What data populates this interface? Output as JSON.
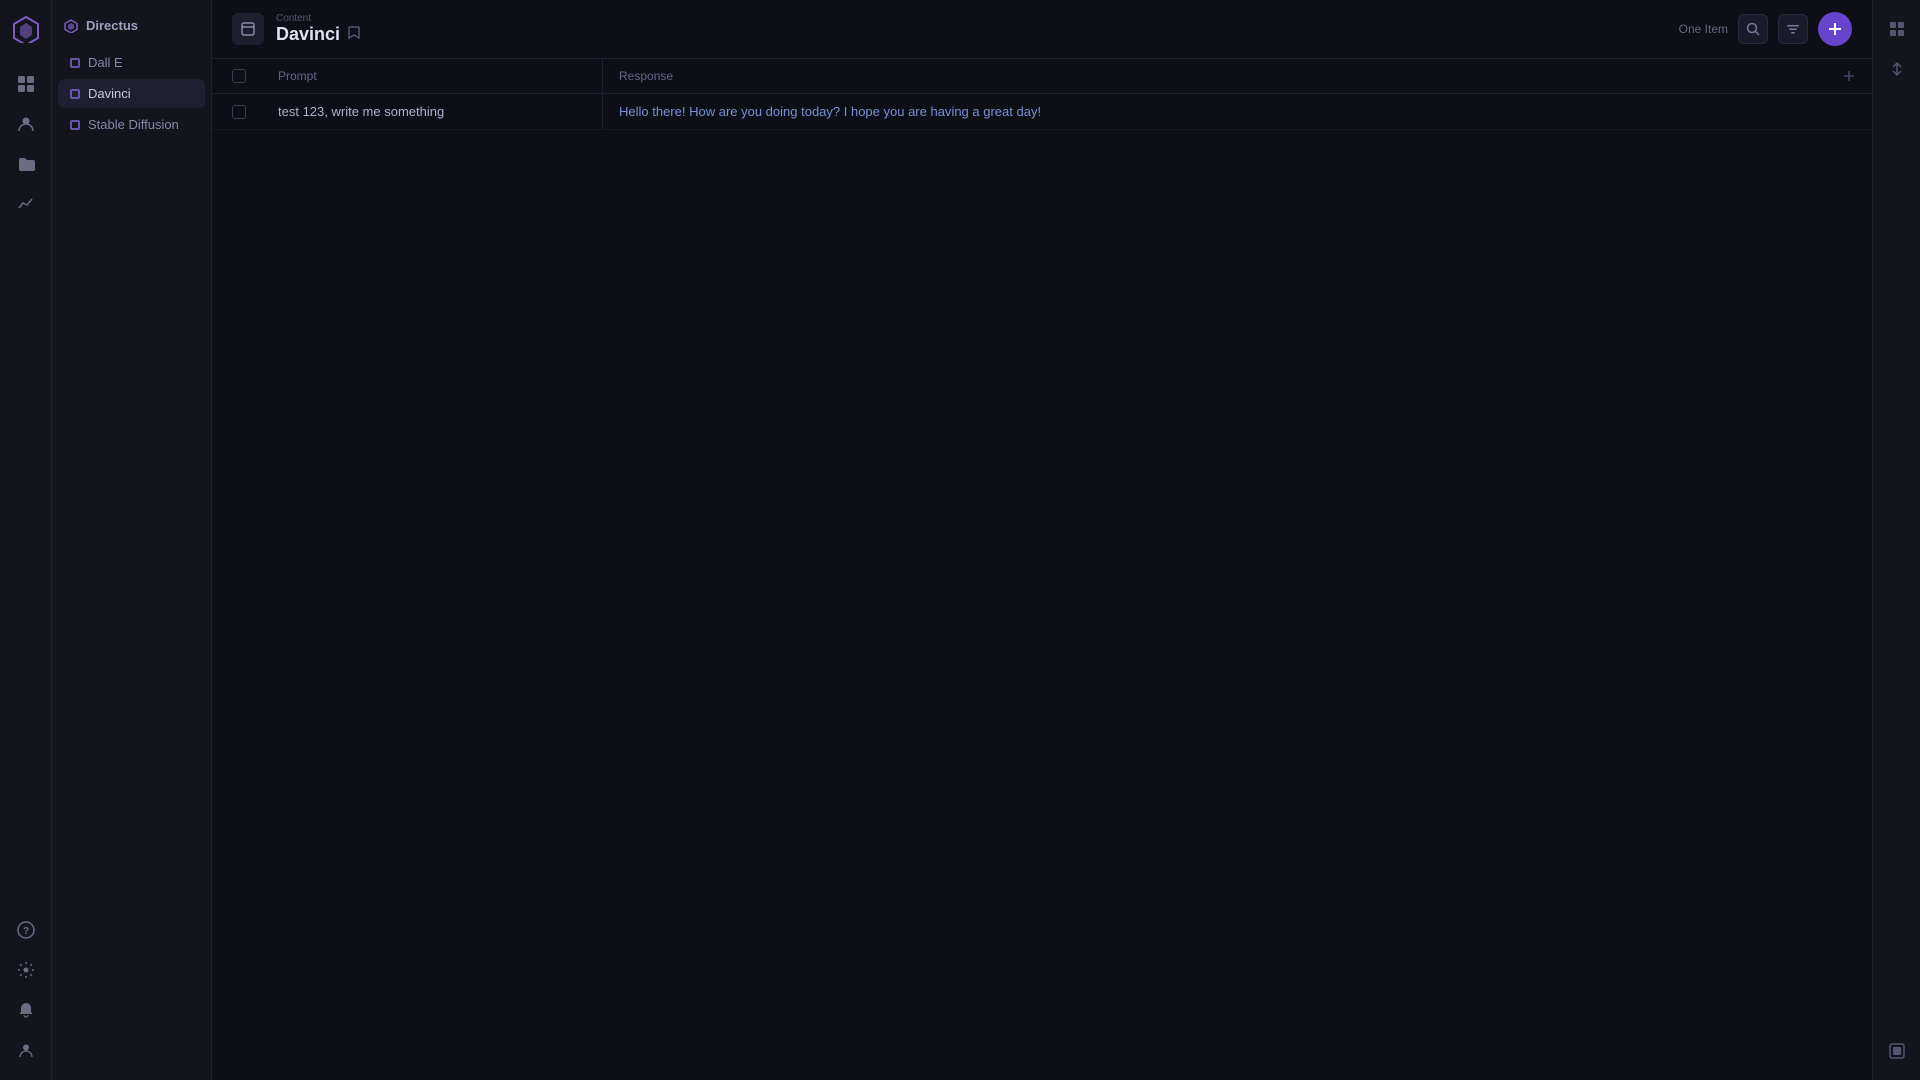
{
  "app": {
    "logo_label": "logo",
    "workspace_name": "Directus"
  },
  "sidebar": {
    "header": "Directus",
    "items": [
      {
        "id": "dall-e",
        "label": "Dall E",
        "active": false
      },
      {
        "id": "davinci",
        "label": "Davinci",
        "active": true
      },
      {
        "id": "stable-diffusion",
        "label": "Stable Diffusion",
        "active": false
      }
    ]
  },
  "header": {
    "breadcrumb": "Content",
    "title": "Davinci",
    "item_count": "One Item"
  },
  "table": {
    "columns": [
      {
        "id": "prompt",
        "label": "Prompt"
      },
      {
        "id": "response",
        "label": "Response"
      }
    ],
    "rows": [
      {
        "id": 1,
        "prompt": "test 123, write me something",
        "response": "Hello there! How are you doing today? I hope you are having a great day!"
      }
    ]
  },
  "icons": {
    "logo": "◈",
    "diamond": "◆",
    "home": "⊞",
    "users": "👤",
    "folder": "⊟",
    "analytics": "∿",
    "help": "?",
    "settings": "⚙",
    "bell": "🔔",
    "profile": "👤",
    "search": "⌕",
    "filter": "⋮",
    "add": "+",
    "bookmark": "🔖",
    "header_icon": "❏",
    "right_panel_1": "⊞",
    "right_panel_2": "↕",
    "right_panel_bottom": "⊡"
  }
}
